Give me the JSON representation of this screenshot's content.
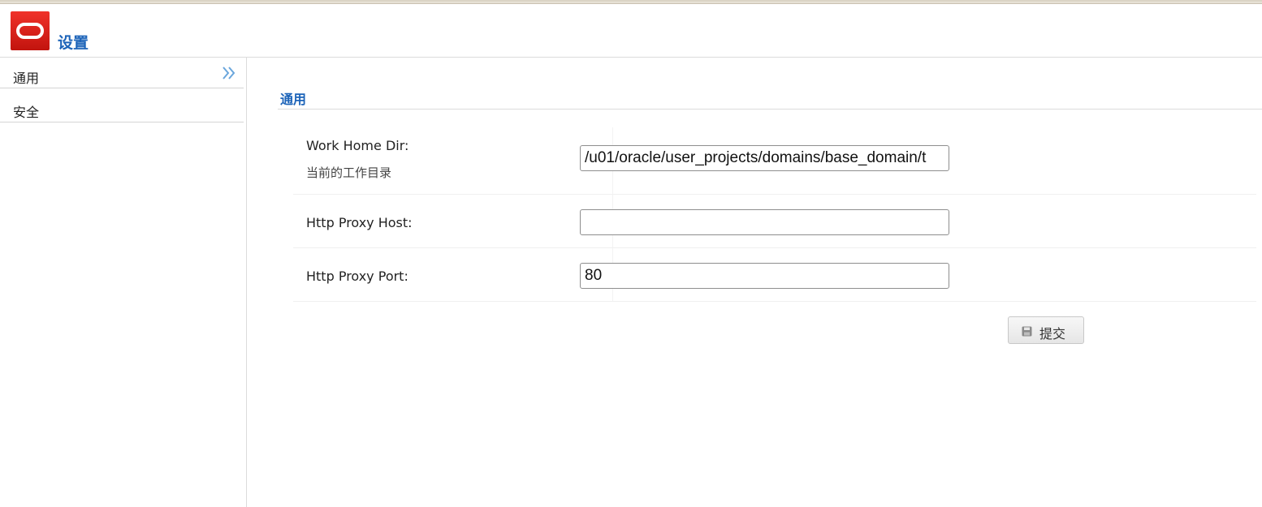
{
  "header": {
    "title": "设置",
    "brand_color": "#c2140e",
    "title_color": "#1d64b9",
    "logo_icon": "oracle-logo-icon"
  },
  "sidebar": {
    "items": [
      {
        "label": "通用",
        "selected": true,
        "icon": "double-chevron-right-icon"
      },
      {
        "label": "安全",
        "selected": false
      }
    ]
  },
  "main": {
    "section_title": "通用",
    "fields": [
      {
        "label": "Work Home Dir:",
        "help": "当前的工作目录",
        "value": "/u01/oracle/user_projects/domains/base_domain/t"
      },
      {
        "label": "Http Proxy Host:",
        "value": ""
      },
      {
        "label": "Http Proxy Port:",
        "value": "80"
      }
    ],
    "submit_label": "提交",
    "submit_icon": "save-icon"
  }
}
